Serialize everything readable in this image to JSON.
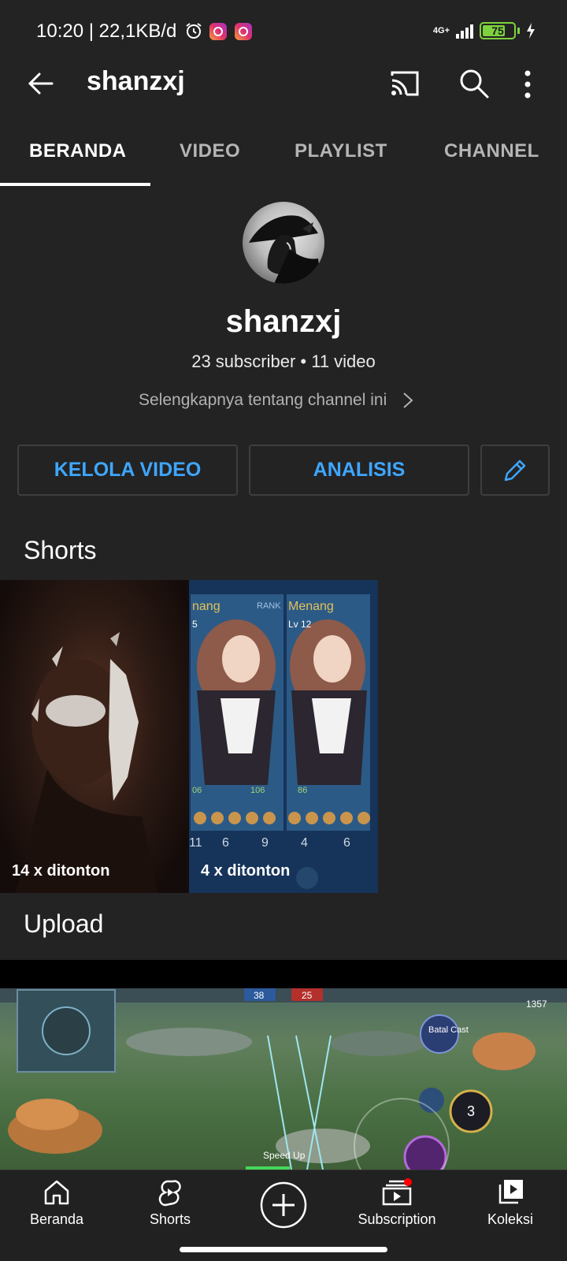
{
  "status_bar": {
    "time_speed": "10:20 | 22,1KB/d",
    "network": "4G+",
    "battery": "75",
    "battery_level": 0.75
  },
  "app_bar": {
    "title": "shanzxj"
  },
  "tabs": [
    {
      "label": "BERANDA",
      "active": true
    },
    {
      "label": "VIDEO",
      "active": false
    },
    {
      "label": "PLAYLIST",
      "active": false
    },
    {
      "label": "CHANNEL",
      "active": false
    }
  ],
  "channel": {
    "name": "shanzxj",
    "stats": "23 subscriber • 11 video",
    "about_link": "Selengkapnya tentang channel ini"
  },
  "actions": {
    "manage_videos": "KELOLA VIDEO",
    "analytics": "ANALISIS"
  },
  "sections": {
    "shorts_title": "Shorts",
    "upload_title": "Upload"
  },
  "shorts": [
    {
      "views": "14 x ditonton"
    },
    {
      "views": "4 x ditonton"
    }
  ],
  "game_ui": {
    "left_result": "nang",
    "rank_label": "RANK",
    "right_result": "Menang",
    "right_level": "Lv 12",
    "left_level": "5",
    "stat_a": "06",
    "stat_b": "106",
    "stat_c": "86",
    "kills_left": "11",
    "deaths_left": "6",
    "assists_left": "9",
    "kills_right": "4",
    "deaths_right": "6",
    "score_blue": "38",
    "score_red": "25",
    "gold": "1357",
    "speed_up": "Speed Up",
    "cast_label": "Batal Cast",
    "skill_count": "3"
  },
  "bottom_nav": [
    {
      "label": "Beranda",
      "icon": "home-icon"
    },
    {
      "label": "Shorts",
      "icon": "shorts-icon"
    },
    {
      "label": "",
      "icon": "create-icon"
    },
    {
      "label": "Subscription",
      "icon": "subscriptions-icon"
    },
    {
      "label": "Koleksi",
      "icon": "library-icon"
    }
  ],
  "colors": {
    "background": "#232323",
    "accent_blue": "#3ea6ff",
    "notification_red": "#ff0000",
    "battery_green": "#7ed23d"
  }
}
